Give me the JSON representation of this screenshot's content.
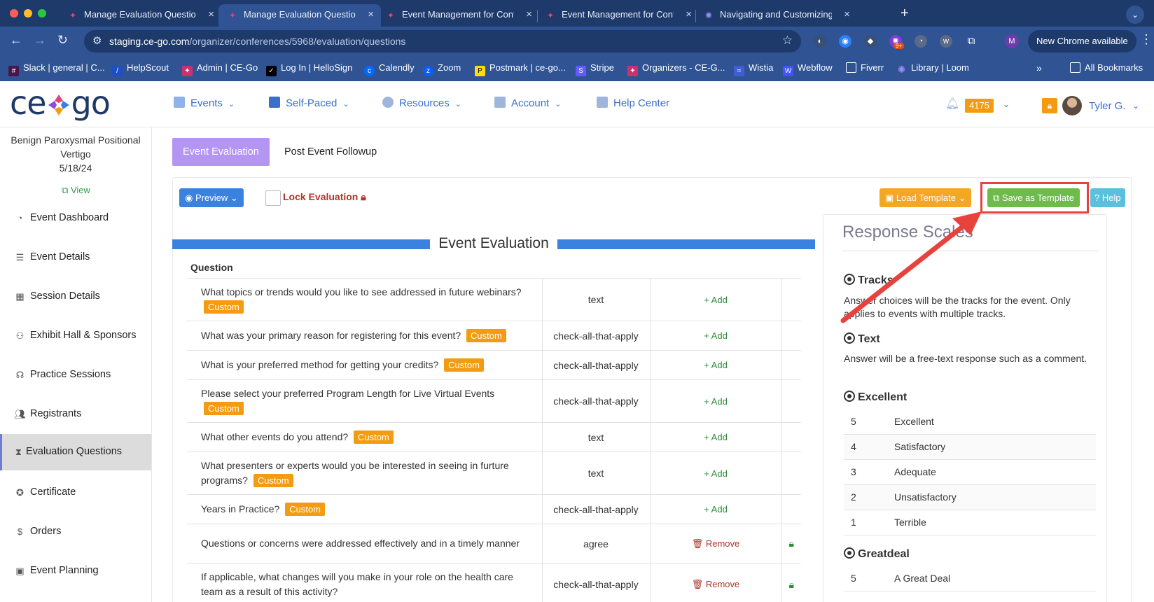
{
  "browser": {
    "tabs": [
      {
        "title": "Manage Evaluation Questions",
        "active": false
      },
      {
        "title": "Manage Evaluation Questions",
        "active": true
      },
      {
        "title": "Event Management for Contin",
        "active": false
      },
      {
        "title": "Event Management for Contin",
        "active": false
      },
      {
        "title": "Navigating and Customizing E",
        "active": false
      }
    ],
    "url_host": "staging.ce-go.com",
    "url_path": "/organizer/conferences/5968/evaluation/questions",
    "new_chrome_label": "New Chrome available",
    "profile_initial": "M",
    "ext_badge": "9+",
    "bookmarks": [
      "Slack | general | C...",
      "HelpScout",
      "Admin | CE-Go",
      "Log In | HelloSign",
      "Calendly",
      "Zoom",
      "Postmark | ce-go...",
      "Stripe",
      "Organizers - CE-G...",
      "Wistia",
      "Webflow",
      "Fiverr",
      "Library | Loom"
    ],
    "all_bookmarks": "All Bookmarks"
  },
  "header": {
    "logo_left": "ce",
    "logo_right": "go",
    "nav": [
      "Events",
      "Self-Paced",
      "Resources",
      "Account",
      "Help Center"
    ],
    "points": "4175",
    "user_name": "Tyler G."
  },
  "sidebar": {
    "event_name": "Benign Paroxysmal Positional Vertigo",
    "event_date": "5/18/24",
    "view_label": "View",
    "items": [
      "Event Dashboard",
      "Event Details",
      "Session Details",
      "Exhibit Hall & Sponsors",
      "Practice Sessions",
      "Registrants",
      "Evaluation Questions",
      "Certificate",
      "Orders",
      "Event Planning"
    ]
  },
  "content": {
    "tabs": [
      "Event Evaluation",
      "Post Event Followup"
    ],
    "preview_label": "Preview",
    "lock_label": "Lock Evaluation",
    "load_template_label": "Load Template",
    "save_template_label": "Save as Template",
    "help_label": "Help",
    "section_title": "Event Evaluation",
    "question_header": "Question",
    "custom_label": "Custom",
    "add_label": "Add",
    "remove_label": "Remove",
    "questions": [
      {
        "text": "What topics or trends would you like to see addressed in future webinars?",
        "type": "text",
        "custom": true,
        "action": "add"
      },
      {
        "text": "What was your primary reason for registering for this event?",
        "type": "check-all-that-apply",
        "custom": true,
        "action": "add"
      },
      {
        "text": "What is your preferred method for getting your credits?",
        "type": "check-all-that-apply",
        "custom": true,
        "action": "add"
      },
      {
        "text": "Please select your preferred Program Length for Live Virtual Events",
        "type": "check-all-that-apply",
        "custom": true,
        "action": "add"
      },
      {
        "text": "What other events do you attend?",
        "type": "text",
        "custom": true,
        "action": "add"
      },
      {
        "text": "What presenters or experts would you be interested in seeing in furture programs?",
        "type": "text",
        "custom": true,
        "action": "add"
      },
      {
        "text": "Years in Practice?",
        "type": "check-all-that-apply",
        "custom": true,
        "action": "add"
      },
      {
        "text": "Questions or concerns were addressed effectively and in a timely manner",
        "type": "agree",
        "custom": false,
        "action": "remove"
      },
      {
        "text": "If applicable, what changes will you make in your role on the health care team as a result of this activity?",
        "type": "check-all-that-apply",
        "custom": false,
        "action": "remove"
      }
    ]
  },
  "response_scales": {
    "title": "Response Scales",
    "tracks_heading": "Tracks",
    "tracks_desc": "Answer choices will be the tracks for the event. Only applies to events with multiple tracks.",
    "text_heading": "Text",
    "text_desc": "Answer will be a free-text response such as a comment.",
    "excellent_heading": "Excellent",
    "excellent_rows": [
      {
        "n": "5",
        "label": "Excellent"
      },
      {
        "n": "4",
        "label": "Satisfactory"
      },
      {
        "n": "3",
        "label": "Adequate"
      },
      {
        "n": "2",
        "label": "Unsatisfactory"
      },
      {
        "n": "1",
        "label": "Terrible"
      }
    ],
    "greatdeal_heading": "Greatdeal",
    "greatdeal_rows": [
      {
        "n": "5",
        "label": "A Great Deal"
      }
    ]
  },
  "colors": {
    "chrome_dark": "#1e3a6b",
    "chrome_mid": "#2f5393",
    "accent_blue": "#3b82e0",
    "tab_purple": "#b495f2",
    "custom_orange": "#f39c12",
    "save_green": "#6dbb4a",
    "annotation_red": "#e8423d"
  }
}
